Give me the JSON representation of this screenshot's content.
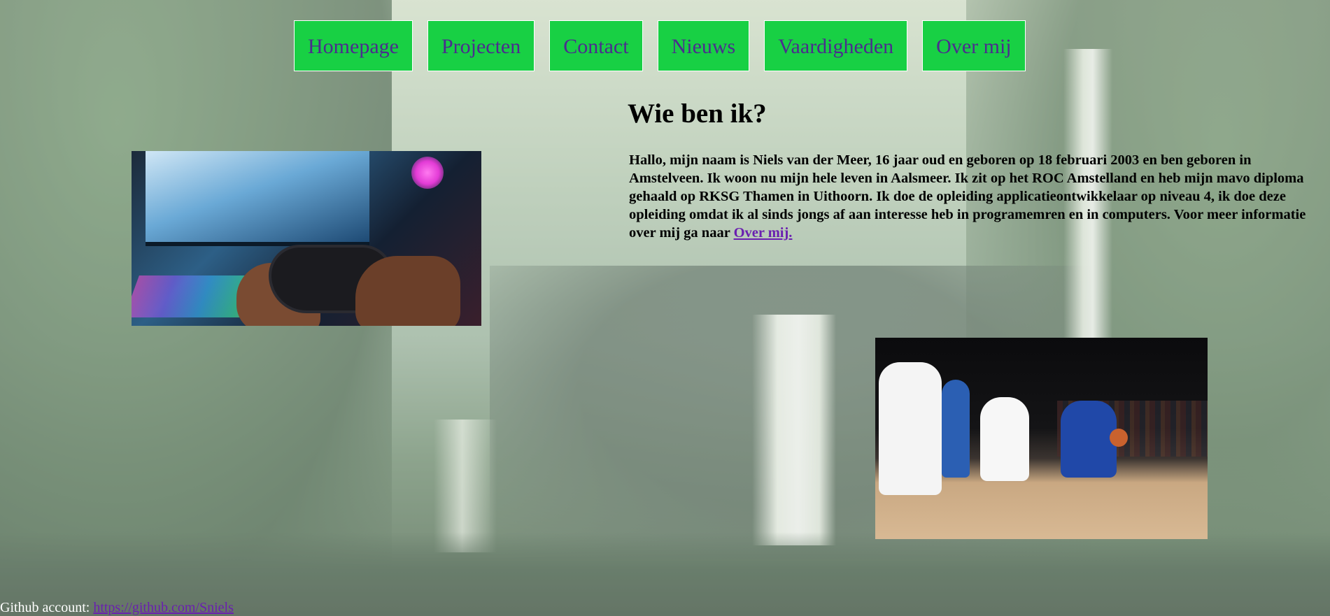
{
  "nav": {
    "items": [
      {
        "label": "Homepage"
      },
      {
        "label": "Projecten"
      },
      {
        "label": "Contact"
      },
      {
        "label": "Nieuws"
      },
      {
        "label": "Vaardigheden"
      },
      {
        "label": "Over mij"
      }
    ]
  },
  "main": {
    "heading": "Wie ben ik?",
    "intro_text": "Hallo, mijn naam is Niels van der Meer, 16 jaar oud en geboren op 18 februari 2003 en ben geboren in Amstelveen. Ik woon nu mijn hele leven in Aalsmeer. Ik zit op het ROC Amstelland en heb mijn mavo diploma gehaald op RKSG Thamen in Uithoorn. Ik doe de opleiding applicatieontwikkelaar op niveau 4, ik doe deze opleiding omdat ik al sinds jongs af aan interesse heb in programemren en in computers. Voor meer informatie over mij ga naar ",
    "intro_link": "Over mij."
  },
  "footer": {
    "label": "Github account: ",
    "link": "https://github.com/Sniels"
  },
  "colors": {
    "nav_background": "#18d044",
    "nav_text": "#4b2d8e",
    "link": "#6a1fb0"
  }
}
